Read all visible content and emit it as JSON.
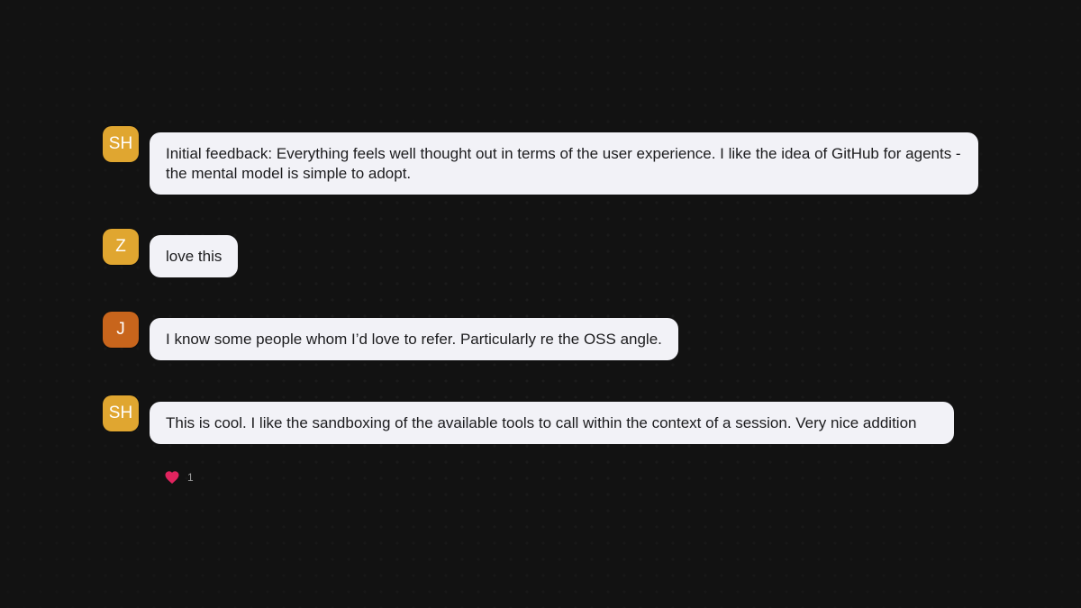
{
  "colors": {
    "background": "#121212",
    "bubble": "#f2f2f7",
    "bubble_text": "#1c1c1e",
    "avatar_sh": "#e0a630",
    "avatar_z": "#e0a630",
    "avatar_j": "#c8651c",
    "heart": "#e0245e"
  },
  "messages": [
    {
      "avatar": "SH",
      "text": "Initial feedback: Everything feels well thought out in terms of the user experience. I like the idea of GitHub for agents - the mental model is simple to adopt."
    },
    {
      "avatar": "Z",
      "text": "love this"
    },
    {
      "avatar": "J",
      "text": "I know some people whom I’d love to refer. Particularly re the OSS angle."
    },
    {
      "avatar": "SH",
      "text": "This is cool. I like the sandboxing of the available tools to call within the context of a session. Very nice addition",
      "reaction": {
        "icon": "heart-icon",
        "count": "1"
      }
    }
  ]
}
